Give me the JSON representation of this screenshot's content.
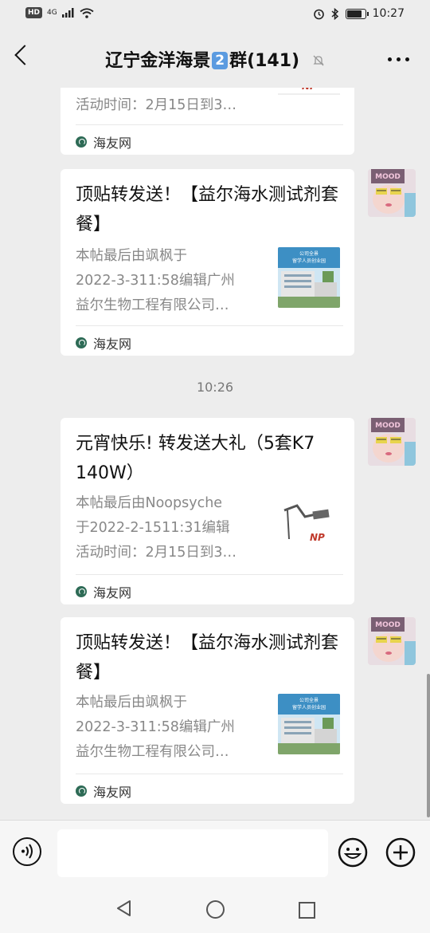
{
  "status_bar": {
    "hd": "HD",
    "network": "4G",
    "time": "10:27"
  },
  "header": {
    "title_prefix": "辽宁金洋海景",
    "title_badge": "2",
    "title_suffix": "群(141)"
  },
  "messages": [
    {
      "type": "link_card",
      "title": "",
      "desc_lines": [
        "活动时间：2月15日到3…"
      ],
      "source": "海友网",
      "thumb": "arm-lamp"
    },
    {
      "type": "link_card",
      "title": "顶贴转发送！【益尔海水测试剂套餐】",
      "desc_lines": [
        "本帖最后由飒枫于",
        "2022-3-311:58编辑广州",
        "益尔生物工程有限公司…"
      ],
      "source": "海友网",
      "thumb": "building"
    },
    {
      "type": "timestamp",
      "text": "10:26"
    },
    {
      "type": "link_card",
      "title": "元宵快乐! 转发送大礼（5套K7  140W）",
      "desc_lines": [
        "本帖最后由Noopsyche",
        "于2022-2-1511:31编辑",
        "活动时间：2月15日到3…"
      ],
      "source": "海友网",
      "thumb": "arm-lamp"
    },
    {
      "type": "link_card",
      "title": "顶贴转发送！【益尔海水测试剂套餐】",
      "desc_lines": [
        "本帖最后由飒枫于",
        "2022-3-311:58编辑广州",
        "益尔生物工程有限公司…"
      ],
      "source": "海友网",
      "thumb": "building"
    }
  ],
  "thumb_text": {
    "lamp_brand": "NP",
    "building_caption_1": "公司全景",
    "building_caption_2": "留学人员创业园"
  },
  "avatar_badge": "MOOD",
  "input_bar": {
    "placeholder": ""
  },
  "icons": {
    "back": "back-arrow-icon",
    "mute": "bell-off-icon",
    "more": "more-dots-icon",
    "voice": "voice-icon",
    "emoji": "emoji-icon",
    "plus": "plus-icon",
    "source": "haiyou-logo-icon"
  },
  "colors": {
    "background": "#ededed",
    "card": "#ffffff",
    "badge_blue": "#5b9be0",
    "source_logo": "#2e6b56"
  }
}
